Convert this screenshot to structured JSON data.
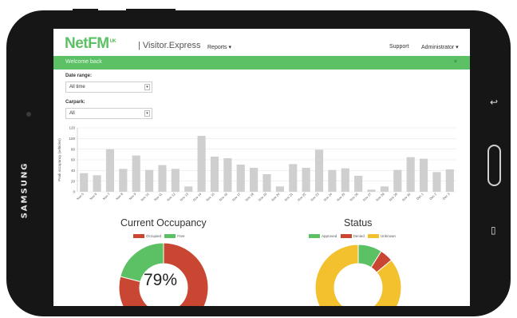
{
  "device": {
    "brand": "SAMSUNG",
    "back_glyph": "↩",
    "recents_glyph": "▯"
  },
  "app": {
    "logo": "NetFM",
    "logo_sup": "UK",
    "product": "| Visitor.Express",
    "nav": {
      "reports": "Reports ▾",
      "support": "Support",
      "admin": "Administrator ▾"
    }
  },
  "banner": {
    "text": "Welcome back",
    "close": "×"
  },
  "filters": {
    "date_range": {
      "label": "Date range:",
      "value": "All time"
    },
    "carpark": {
      "label": "Carpark:",
      "value": "All"
    }
  },
  "colors": {
    "brand": "#5cc165",
    "occupied": "#c84632",
    "free": "#5cc165",
    "approved": "#5cc165",
    "denied": "#c84632",
    "unknown": "#f3c02e",
    "bar": "#cfcfcf"
  },
  "chart_data": [
    {
      "type": "bar",
      "xlabel": "",
      "ylabel": "Peak occupancy (vehicles)",
      "ylim": [
        0,
        120
      ],
      "yticks": [
        "0",
        "20",
        "40",
        "60",
        "80",
        "100",
        "120"
      ],
      "grid": true,
      "categories": [
        "Nov 5",
        "Nov 6",
        "Nov 7",
        "Nov 8",
        "Nov 9",
        "Nov 10",
        "Nov 11",
        "Nov 12",
        "Nov 13",
        "Nov 14",
        "Nov 15",
        "Nov 16",
        "Nov 17",
        "Nov 18",
        "Nov 19",
        "Nov 20",
        "Nov 21",
        "Nov 22",
        "Nov 23",
        "Nov 24",
        "Nov 25",
        "Nov 26",
        "Nov 27",
        "Nov 28",
        "Nov 29",
        "Nov 30",
        "Dec 1",
        "Dec 2",
        "Dec 3"
      ],
      "values": [
        35,
        31,
        80,
        43,
        68,
        41,
        50,
        43,
        10,
        105,
        66,
        63,
        51,
        45,
        33,
        10,
        52,
        45,
        79,
        41,
        44,
        30,
        4,
        10,
        41,
        65,
        62,
        37,
        42
      ]
    },
    {
      "type": "pie",
      "title": "Current Occupancy",
      "labels": [
        "Occupied",
        "Free"
      ],
      "values": [
        79,
        21
      ],
      "center_label": "79%"
    },
    {
      "type": "pie",
      "title": "Status",
      "labels": [
        "Approved",
        "Denied",
        "Unknown"
      ],
      "values": [
        9,
        5,
        86
      ]
    }
  ]
}
